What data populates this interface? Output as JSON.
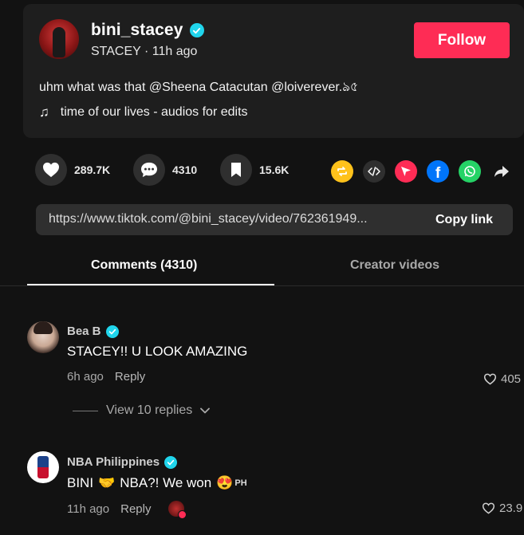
{
  "post": {
    "username": "bini_stacey",
    "display_name": "STACEY",
    "time_ago": "11h ago",
    "subline_sep": " · ",
    "follow_label": "Follow",
    "caption": "uhm what was that @Sheena Catacutan @loiverever.ঌ৫",
    "music_title": "time of our lives - audios for edits"
  },
  "actions": {
    "likes": "289.7K",
    "comments": "4310",
    "saves": "15.6K"
  },
  "share_icons": [
    "repost-icon",
    "embed-icon",
    "send-icon",
    "facebook-icon",
    "whatsapp-icon",
    "share-arrow-icon"
  ],
  "colors": {
    "accent": "#fe2c55",
    "verified": "#20d5ec",
    "repost": "#ffc21b",
    "send": "#fe2c55",
    "facebook": "#0075fa",
    "whatsapp": "#25d366"
  },
  "link": {
    "url": "https://www.tiktok.com/@bini_stacey/video/762361949...",
    "copy_label": "Copy link"
  },
  "tabs": {
    "comments": "Comments (4310)",
    "creator": "Creator videos"
  },
  "comments": [
    {
      "name": "Bea B",
      "text": "STACEY!! U LOOK AMAZING",
      "time": "6h ago",
      "reply_label": "Reply",
      "likes": "405",
      "view_replies": "View 10 replies"
    },
    {
      "name": "NBA Philippines",
      "text_a": "BINI",
      "text_b": "NBA?! We won",
      "text_emoji_1": "🤝",
      "text_emoji_2": "😍",
      "text_tag": "PH",
      "time": "11h ago",
      "reply_label": "Reply",
      "likes": "23.9"
    }
  ]
}
